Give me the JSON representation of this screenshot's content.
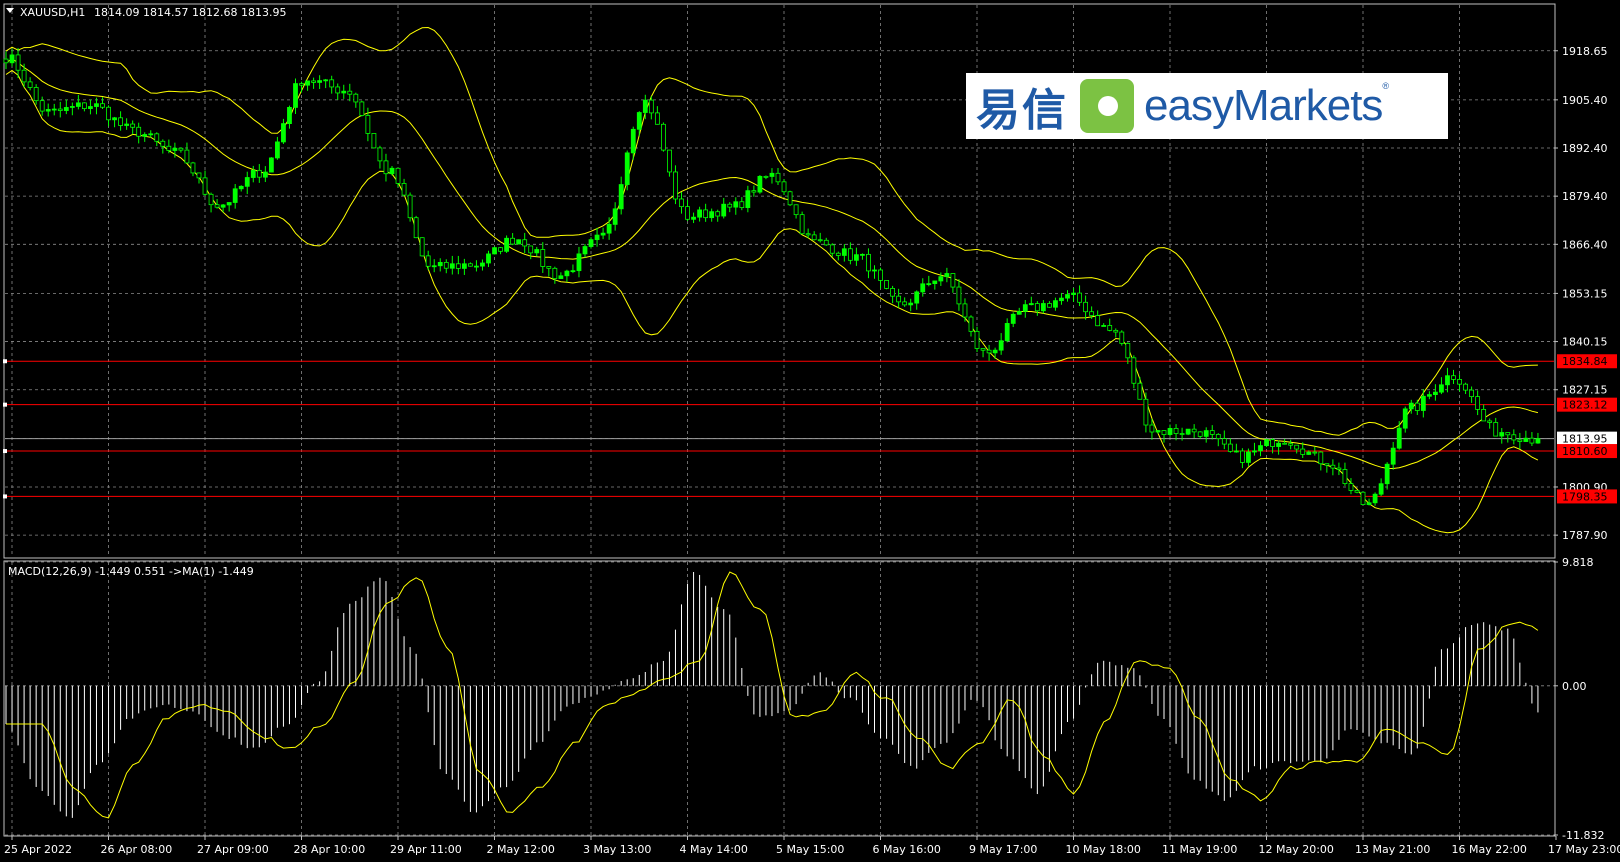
{
  "header": {
    "symbol_label": "XAUUSD,H1",
    "ohlc_label": "1814.09 1814.57 1812.68 1813.95"
  },
  "macd": {
    "label": "MACD(12,26,9) -1.449 0.551  ->MA(1) -1.449"
  },
  "logo": {
    "chinese_text": "易信",
    "english_text": "easyMarkets",
    "registered_mark": "®"
  },
  "colors": {
    "background": "#000000",
    "candles": "#00ff00",
    "bands": "#ffff00",
    "macd_hist": "#ffffff",
    "signal": "#ffff00",
    "grid": "#8a8a8a",
    "level_lines": "#ff0000",
    "current_price": "#a0a0a0"
  },
  "chart_data": [
    {
      "type": "candlestick",
      "title": "XAUUSD,H1",
      "y_ticks": [
        "1918.65",
        "1905.40",
        "1892.40",
        "1879.40",
        "1866.40",
        "1853.15",
        "1840.15",
        "1827.15",
        "1813.95",
        "1800.90",
        "1787.90"
      ],
      "ylim": [
        1782.0,
        1931.0
      ],
      "x_ticks": [
        "25 Apr 2022",
        "26 Apr 08:00",
        "27 Apr 09:00",
        "28 Apr 10:00",
        "29 Apr 11:00",
        "2 May 12:00",
        "3 May 13:00",
        "4 May 14:00",
        "5 May 15:00",
        "6 May 16:00",
        "9 May 17:00",
        "10 May 18:00",
        "11 May 19:00",
        "12 May 20:00",
        "13 May 21:00",
        "16 May 22:00",
        "17 May 23:00"
      ],
      "bars_per_tick": 16,
      "current_price": 1813.95,
      "levels": [
        1834.84,
        1823.12,
        1810.6,
        1798.35
      ],
      "level_labels": [
        "1834.84",
        "1823.12",
        "1810.60",
        "1798.35"
      ],
      "close_anchors": [
        1917.0,
        1902.0,
        1904.0,
        1897.0,
        1891.0,
        1877.0,
        1886.0,
        1911.0,
        1908.0,
        1886.0,
        1860.0,
        1861.0,
        1868.0,
        1858.0,
        1868.0,
        1905.0,
        1874.0,
        1876.0,
        1885.0,
        1867.0,
        1863.0,
        1850.0,
        1858.0,
        1837.0,
        1849.0,
        1852.0,
        1843.0,
        1816.0,
        1816.0,
        1809.0,
        1814.0,
        1808.0,
        1796.0,
        1822.0,
        1831.0,
        1816.0,
        1813.95
      ],
      "band_width": 9
    },
    {
      "type": "bar",
      "title": "MACD(12,26,9) -1.449 0.551  ->MA(1) -1.449",
      "y_ticks": [
        "9.818",
        "0.00",
        "-11.832"
      ],
      "ylim": [
        -11.832,
        9.818
      ],
      "hist_anchors": [
        -3.0,
        -8.0,
        -10.5,
        -6.0,
        -2.5,
        -1.5,
        -2.0,
        -4.0,
        -5.0,
        -3.0,
        0.5,
        6.5,
        8.5,
        3.0,
        -7.0,
        -10.0,
        -8.0,
        -4.5,
        -1.5,
        -0.5,
        0.5,
        2.0,
        9.0,
        6.0,
        -2.5,
        -2.0,
        1.0,
        -1.0,
        -4.0,
        -6.5,
        -4.5,
        -1.0,
        -5.5,
        -8.5,
        -3.0,
        2.0,
        1.5,
        -2.5,
        -7.5,
        -9.0,
        -6.5,
        -6.0,
        -6.0,
        -3.5,
        -4.5,
        -5.5,
        3.0,
        5.0,
        4.5,
        -2.0
      ],
      "signal_lag": 6
    }
  ]
}
